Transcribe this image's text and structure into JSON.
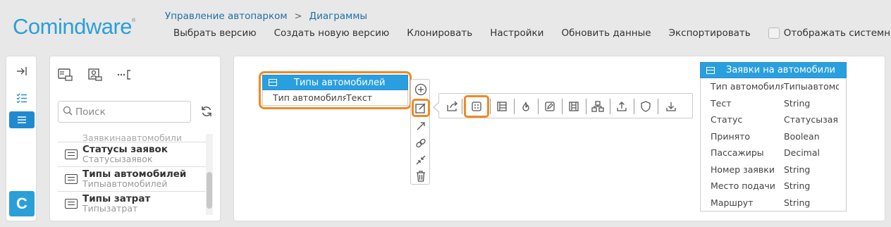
{
  "app": {
    "logo": "Comindware",
    "logo_mark": "®"
  },
  "breadcrumb": {
    "parent": "Управление автопарком",
    "separator": ">",
    "current": "Диаграммы"
  },
  "toolbar": {
    "select_version": "Выбрать версию",
    "create_version": "Создать новую версию",
    "clone": "Клонировать",
    "settings": "Настройки",
    "refresh": "Обновить данные",
    "export": "Экспортировать",
    "show_system": "Отображать системные и"
  },
  "rail": {
    "collapse_icon": "collapse-right-icon",
    "checklist_icon": "checklist-icon",
    "list_icon": "list-icon",
    "brand_letter": "C"
  },
  "side": {
    "search_placeholder": "Поиск",
    "items": [
      {
        "title": "",
        "sub": "Заявкинаавтомобили"
      },
      {
        "title": "Статусы заявок",
        "sub": "Статусызаявок"
      },
      {
        "title": "Типы автомобилей",
        "sub": "Типыавтомобилей"
      },
      {
        "title": "Типы затрат",
        "sub": "Типызатрат"
      }
    ]
  },
  "canvas": {
    "small_entity": {
      "title": "Типы автомобилей",
      "row": {
        "name": "Тип автомобиля",
        "type": "Текст"
      }
    },
    "big_entity": {
      "title": "Заявки на автомобили",
      "rows": [
        {
          "name": "Тип автомобиля",
          "type": "Типыавтомобилей"
        },
        {
          "name": "Тест",
          "type": "String"
        },
        {
          "name": "Статус",
          "type": "Статусызаявок"
        },
        {
          "name": "Принято",
          "type": "Boolean"
        },
        {
          "name": "Пассажиры",
          "type": "Decimal"
        },
        {
          "name": "Номер заявки",
          "type": "String"
        },
        {
          "name": "Место подачи",
          "type": "String"
        },
        {
          "name": "Маршрут",
          "type": "String"
        }
      ]
    }
  },
  "colors": {
    "accent": "#2a9fe0",
    "highlight": "#f08a24",
    "brand": "#2a9fd8"
  }
}
